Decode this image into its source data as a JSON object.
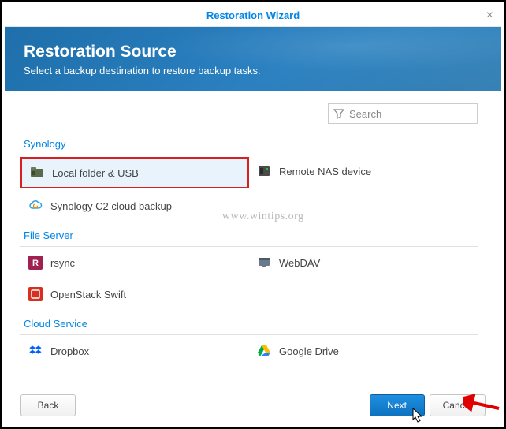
{
  "dialog": {
    "title": "Restoration Wizard",
    "close_glyph": "×"
  },
  "hero": {
    "heading": "Restoration Source",
    "sub": "Select a backup destination to restore backup tasks."
  },
  "search": {
    "placeholder": "Search"
  },
  "sections": [
    {
      "title": "Synology",
      "items": [
        {
          "label": "Local folder & USB",
          "icon": "folder-nas",
          "selected": true
        },
        {
          "label": "Remote NAS device",
          "icon": "nas-remote"
        },
        {
          "label": "Synology C2 cloud backup",
          "icon": "cloud-c2"
        }
      ]
    },
    {
      "title": "File Server",
      "items": [
        {
          "label": "rsync",
          "icon": "rsync"
        },
        {
          "label": "WebDAV",
          "icon": "webdav"
        },
        {
          "label": "OpenStack Swift",
          "icon": "openstack"
        }
      ]
    },
    {
      "title": "Cloud Service",
      "items": [
        {
          "label": "Dropbox",
          "icon": "dropbox"
        },
        {
          "label": "Google Drive",
          "icon": "gdrive"
        }
      ]
    }
  ],
  "footer": {
    "back": "Back",
    "next": "Next",
    "cancel": "Cancel"
  },
  "watermark": "www.wintips.org"
}
